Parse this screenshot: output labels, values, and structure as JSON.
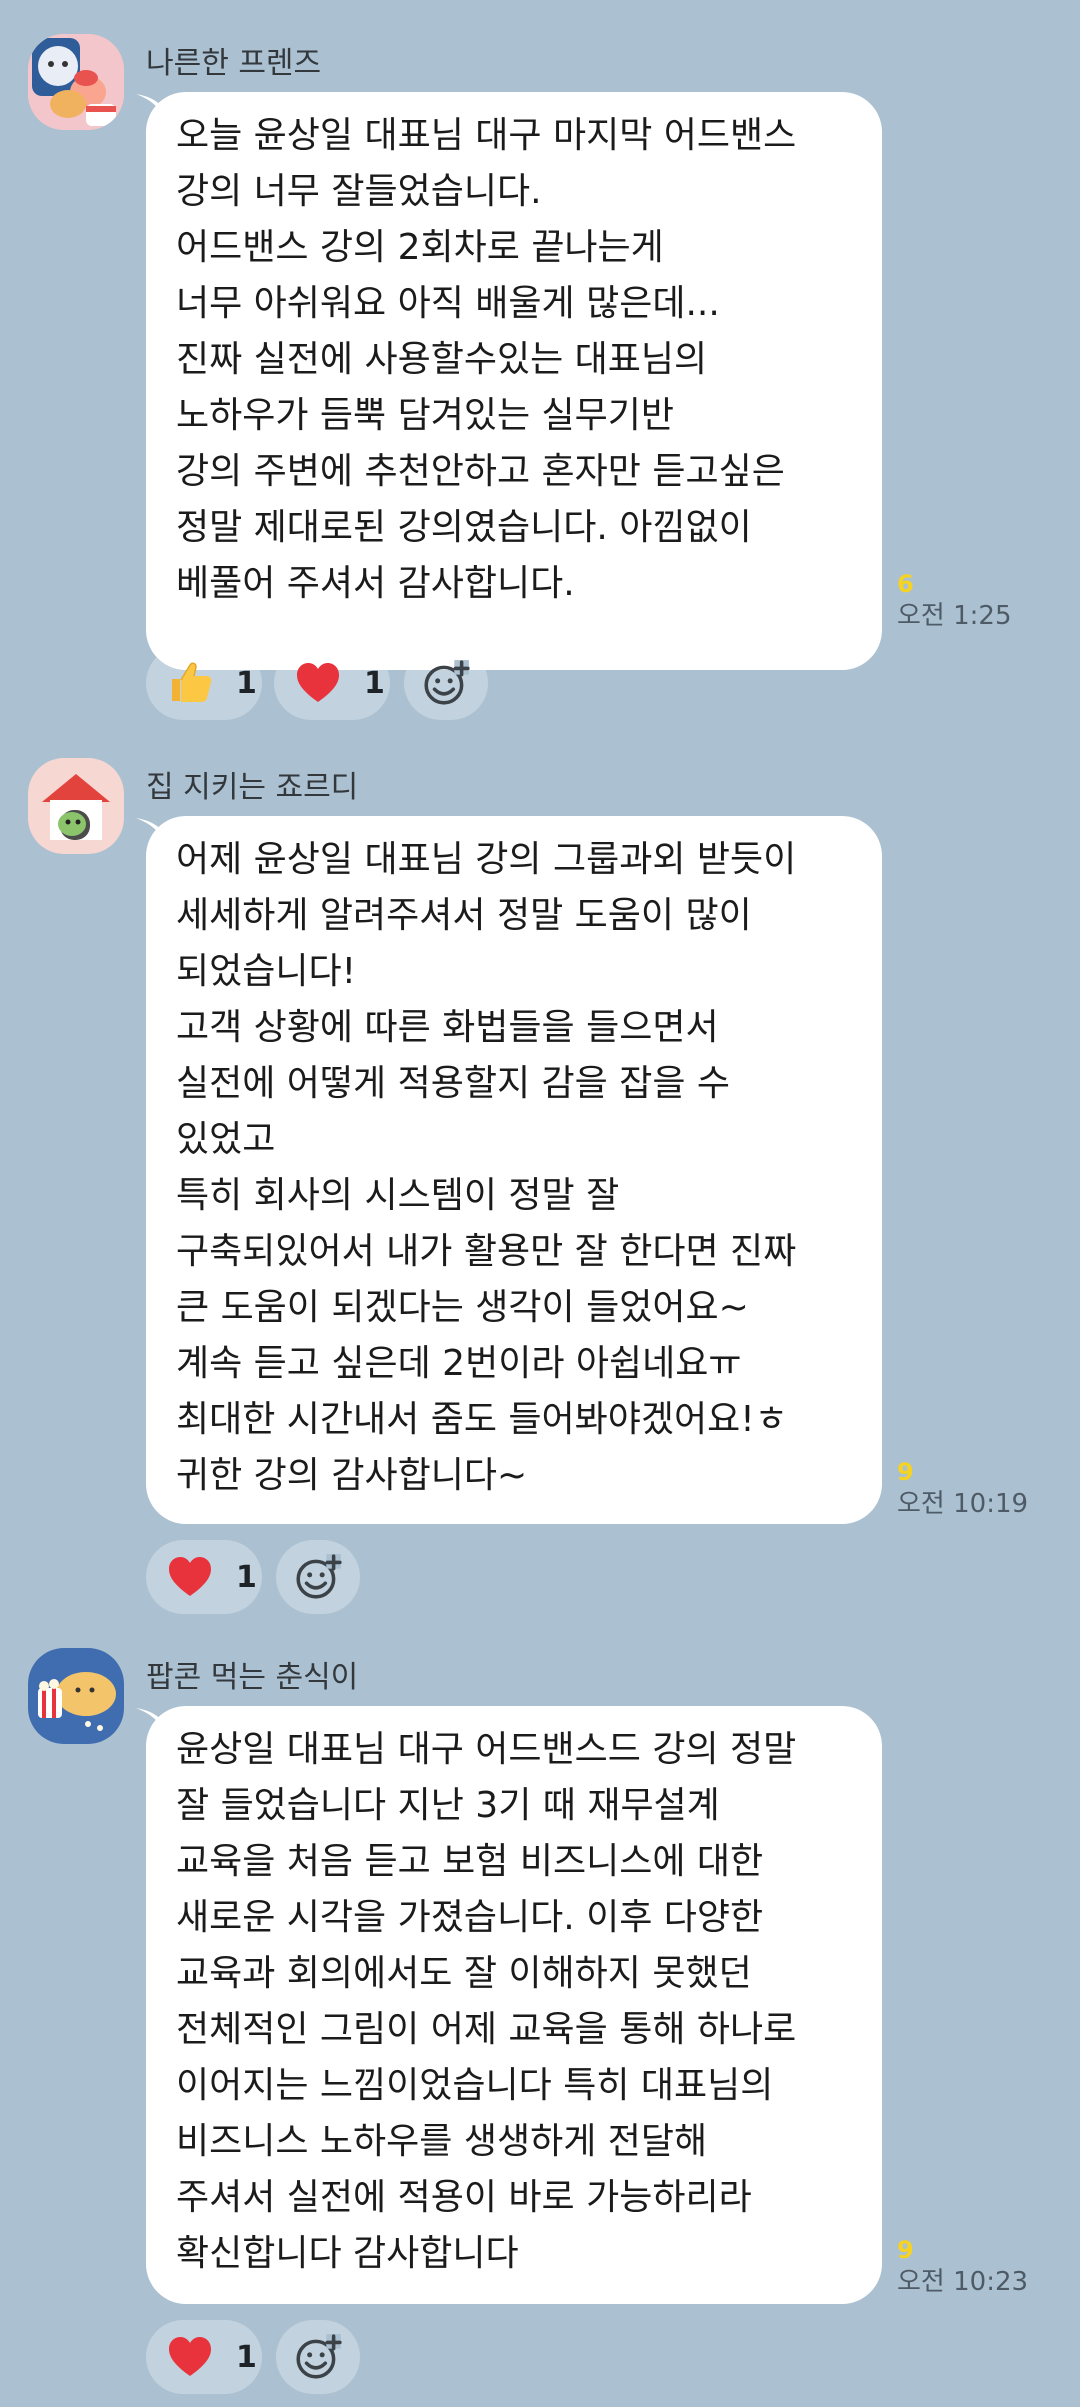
{
  "messages": [
    {
      "sender": "나른한 프렌즈",
      "avatar_icon": "ryan-apeach-cake-icon",
      "text": "오늘 윤상일 대표님 대구 마지막 어드밴스\n강의 너무 잘들었습니다.\n어드밴스 강의 2회차로 끝나는게\n너무 아쉬워요 아직 배울게 많은데...\n진짜 실전에 사용할수있는 대표님의\n 노하우가 듬뿍 담겨있는 실무기반\n강의 주변에 추천안하고 혼자만 듣고싶은\n정말 제대로된 강의였습니다. 아낌없이\n베풀어 주셔서 감사합니다.",
      "unread": "6",
      "time": "오전 1:25",
      "reactions": [
        {
          "icon": "thumbs-up-icon",
          "count": "1"
        },
        {
          "icon": "heart-icon",
          "count": "1"
        }
      ]
    },
    {
      "sender": "집 지키는 죠르디",
      "avatar_icon": "jordy-doghouse-icon",
      "text": "어제 윤상일 대표님 강의 그룹과외 받듯이\n세세하게 알려주셔서 정말 도움이 많이\n되었습니다!\n고객 상황에 따른 화법들을 들으면서\n실전에 어떻게 적용할지 감을 잡을 수\n있었고\n특히 회사의 시스템이 정말 잘\n구축되있어서 내가 활용만 잘 한다면 진짜\n큰 도움이 되겠다는 생각이 들었어요~\n계속 듣고 싶은데 2번이라 아쉽네요ㅠ\n최대한 시간내서 줌도 들어봐야겠어요!ㅎ\n귀한 강의 감사합니다~",
      "unread": "9",
      "time": "오전 10:19",
      "reactions": [
        {
          "icon": "heart-icon",
          "count": "1"
        }
      ]
    },
    {
      "sender": "팝콘 먹는 춘식이",
      "avatar_icon": "choonsik-popcorn-icon",
      "text": "윤상일 대표님 대구 어드밴스드 강의 정말\n잘 들었습니다 지난 3기 때 재무설계\n교육을 처음 듣고 보험 비즈니스에 대한\n새로운 시각을 가졌습니다. 이후 다양한\n교육과 회의에서도 잘 이해하지 못했던\n전체적인 그림이 어제 교육을 통해 하나로\n이어지는 느낌이었습니다 특히 대표님의\n비즈니스 노하우를 생생하게 전달해\n주셔서 실전에 적용이 바로 가능하리라\n확신합니다 감사합니다",
      "unread": "9",
      "time": "오전 10:23",
      "reactions": [
        {
          "icon": "heart-icon",
          "count": "1"
        }
      ]
    }
  ],
  "colors": {
    "background": "#abc1d1",
    "bubble": "#ffffff",
    "unread": "#f5d320",
    "heart": "#e8323c"
  },
  "add_reaction_icon": "add-emoji-icon"
}
